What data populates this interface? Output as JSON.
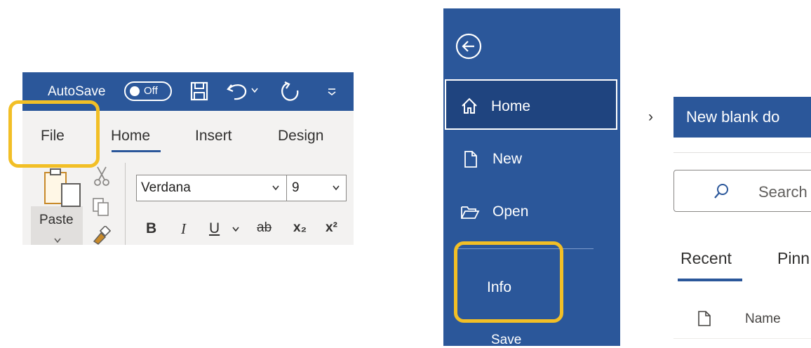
{
  "ribbon": {
    "autosave_label": "AutoSave",
    "autosave_state": "Off",
    "tabs": [
      "File",
      "Home",
      "Insert",
      "Design"
    ],
    "active_tab": "Home",
    "paste_label": "Paste",
    "font_name": "Verdana",
    "font_size": "9",
    "format_buttons": [
      "B",
      "I",
      "U",
      "ab",
      "x₂",
      "x²"
    ],
    "accent_color": "#2b579a",
    "highlight_color": "#f2bf26"
  },
  "backstage": {
    "nav_items": [
      "Home",
      "New",
      "Open",
      "Info",
      "Save"
    ],
    "active_item": "Home",
    "new_blank_label": "New blank do",
    "search_placeholder": "Search",
    "tabs": [
      "Recent",
      "Pinn"
    ],
    "active_tab": "Recent",
    "list_column": "Name"
  }
}
